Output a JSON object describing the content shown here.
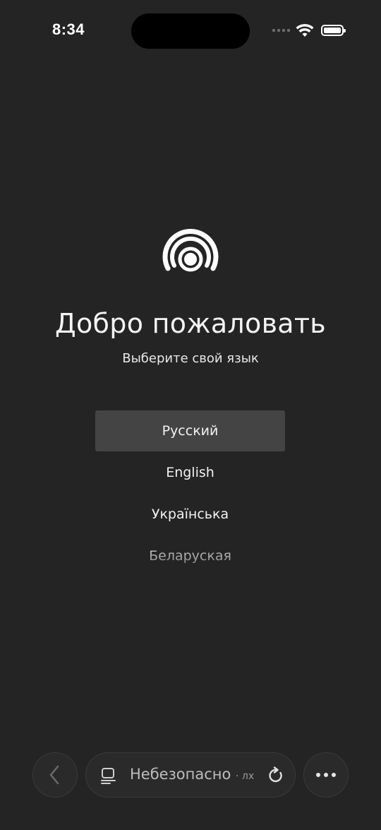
{
  "status_bar": {
    "time": "8:34"
  },
  "welcome": {
    "title": "Добро пожаловать",
    "subtitle": "Выберите свой язык"
  },
  "languages": [
    {
      "label": "Русский",
      "selected": true
    },
    {
      "label": "English",
      "selected": false
    },
    {
      "label": "Українська",
      "selected": false
    },
    {
      "label": "Беларуская",
      "selected": false
    }
  ],
  "browser_bar": {
    "security_label": "Небезопасно",
    "domain_fragment": "· лх"
  },
  "colors": {
    "background": "#242424",
    "selected_item": "#444444",
    "text": "#ffffff"
  }
}
